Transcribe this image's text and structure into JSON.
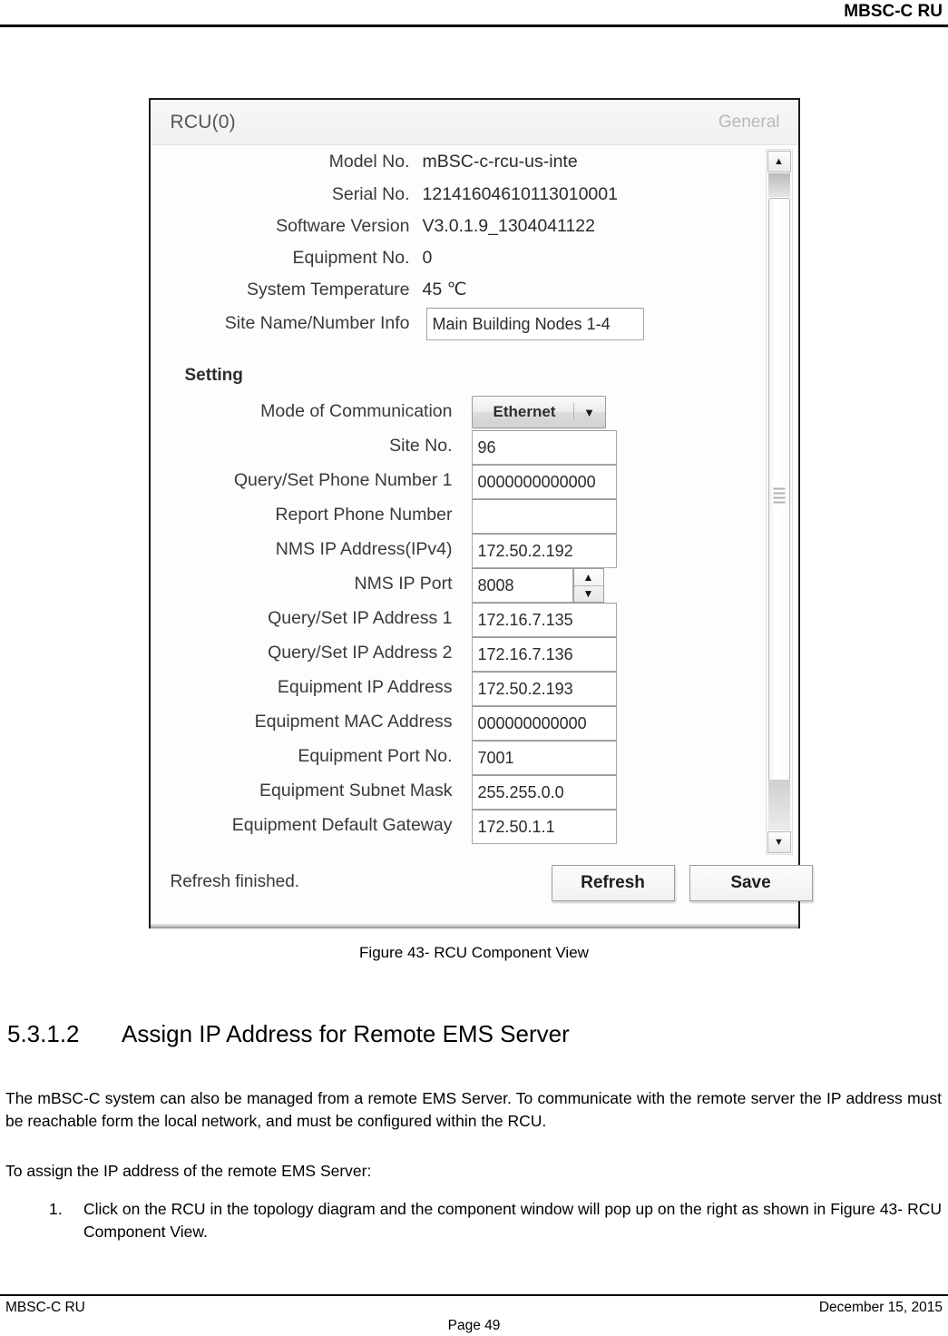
{
  "page": {
    "header_title": "MBSC-C RU",
    "footer_left": "MBSC-C RU",
    "footer_right": "December 15, 2015",
    "footer_center": "Page 49"
  },
  "figure": {
    "caption": "Figure 43- RCU Component View"
  },
  "dialog": {
    "title": "RCU(0)",
    "tab_label": "General",
    "info_rows": [
      {
        "label": "Model No.",
        "value": "mBSC-c-rcu-us-inte"
      },
      {
        "label": "Serial No.",
        "value": "12141604610113010001"
      },
      {
        "label": "Software Version",
        "value": "V3.0.1.9_1304041122"
      },
      {
        "label": "Equipment No.",
        "value": "0"
      },
      {
        "label": "System Temperature",
        "value": "45   ℃"
      }
    ],
    "site_name": {
      "label": "Site Name/Number Info",
      "value": "Main Building Nodes 1-4"
    },
    "setting": {
      "section_label": "Setting",
      "mode": {
        "label": "Mode of Communication",
        "value": "Ethernet",
        "arrow_glyph": "▼"
      },
      "port": {
        "label": "NMS IP Port",
        "value": "8008",
        "up_glyph": "▲",
        "down_glyph": "▼"
      },
      "fields": [
        {
          "label": "Site No.",
          "value": "96"
        },
        {
          "label": "Query/Set Phone Number 1",
          "value": "0000000000000"
        },
        {
          "label": "Report Phone Number",
          "value": ""
        },
        {
          "label": "NMS IP Address(IPv4)",
          "value": "172.50.2.192"
        },
        {
          "label": "Query/Set IP Address 1",
          "value": "172.16.7.135"
        },
        {
          "label": "Query/Set IP Address 2",
          "value": "172.16.7.136"
        },
        {
          "label": "Equipment IP Address",
          "value": "172.50.2.193"
        },
        {
          "label": "Equipment MAC Address",
          "value": "000000000000"
        },
        {
          "label": "Equipment Port No.",
          "value": "7001"
        },
        {
          "label": "Equipment Subnet Mask",
          "value": "255.255.0.0"
        },
        {
          "label": "Equipment Default Gateway",
          "value": "172.50.1.1"
        }
      ]
    },
    "status_text": "Refresh finished.",
    "buttons": {
      "refresh": "Refresh",
      "save": "Save"
    },
    "scrollbar": {
      "up_glyph": "▲",
      "down_glyph": "▼"
    }
  },
  "body": {
    "heading_number": "5.3.1.2",
    "heading_text": "Assign IP Address for Remote EMS Server",
    "paragraph_1": "The mBSC-C system can also be managed from a remote EMS Server. To communicate with the remote server the IP address must be reachable form the local network, and must be configured within the RCU.",
    "paragraph_2": "To assign the IP address of the remote EMS Server:",
    "list_items": [
      {
        "marker": "1.",
        "text": "Click on the RCU in the topology diagram and the component window will pop up on the right as shown in Figure 43- RCU Component View."
      }
    ]
  }
}
